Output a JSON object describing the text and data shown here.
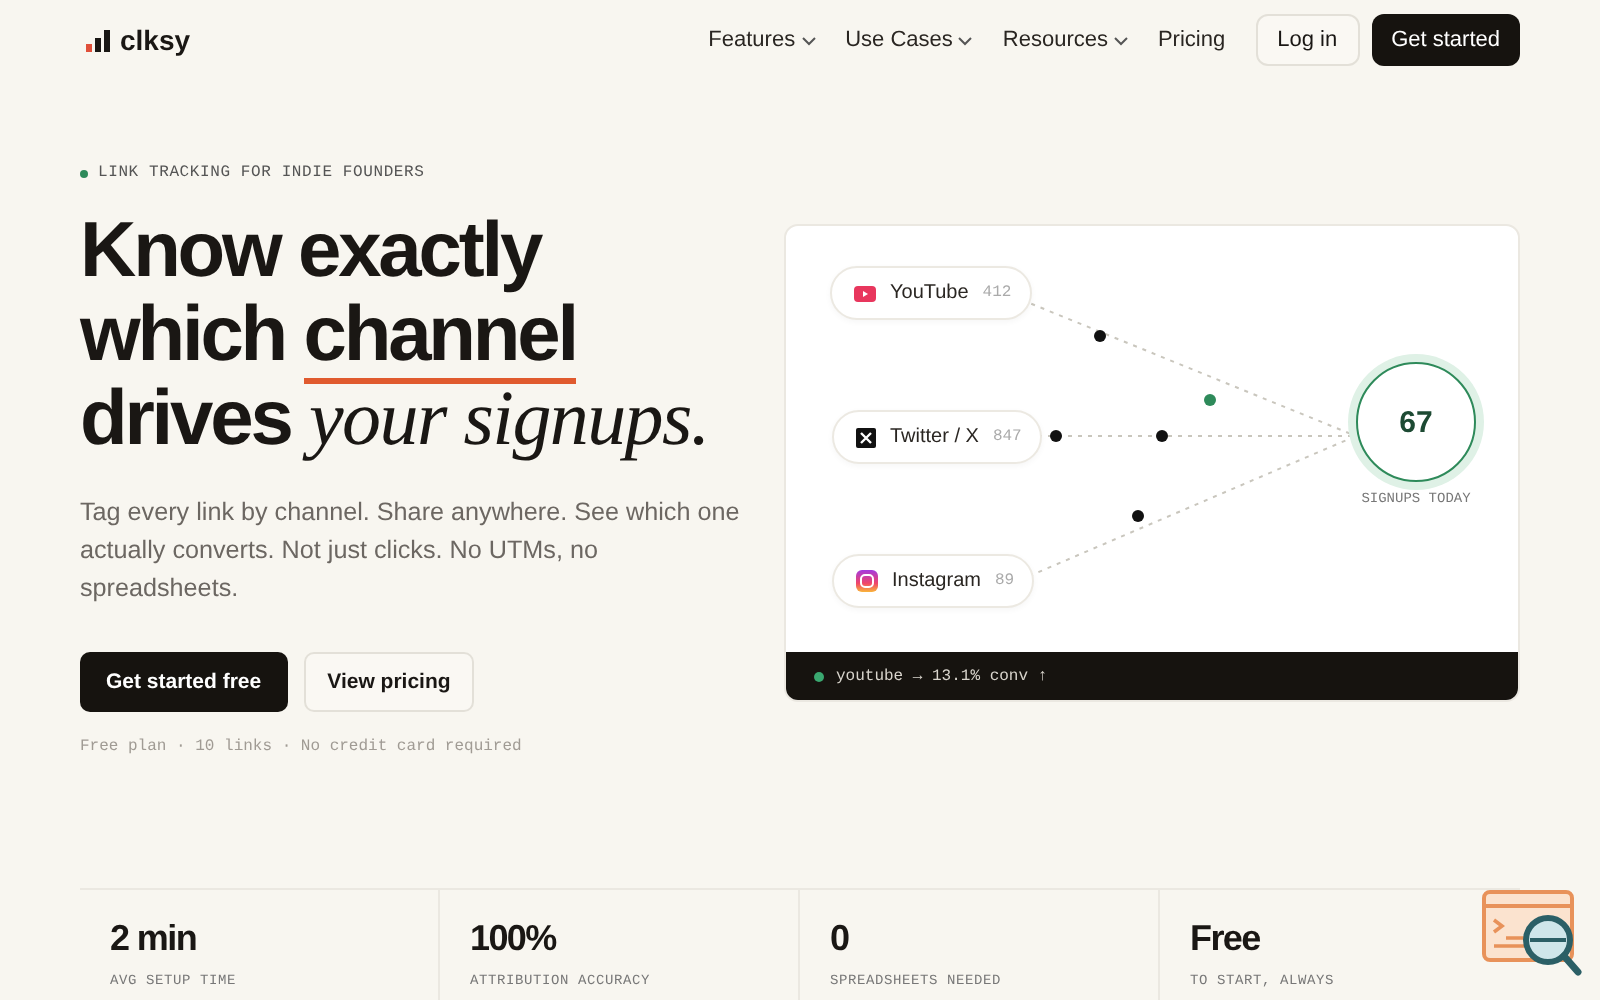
{
  "nav": {
    "logo": "clksy",
    "links": [
      {
        "label": "Features",
        "dropdown": true
      },
      {
        "label": "Use Cases",
        "dropdown": true
      },
      {
        "label": "Resources",
        "dropdown": true
      },
      {
        "label": "Pricing",
        "dropdown": false
      }
    ],
    "login": "Log in",
    "cta": "Get started"
  },
  "hero": {
    "eyebrow": "LINK TRACKING FOR INDIE FOUNDERS",
    "headline": {
      "before": "Know exactly which",
      "underlined": "channel",
      "after": "drives",
      "italic": "your signups."
    },
    "subtitle": "Tag every link by channel. Share anywhere. See which one actually converts. Not just clicks. No UTMs, no spreadsheets.",
    "primary_button": "Get started free",
    "secondary_button": "View pricing",
    "note": "Free plan · 10 links · No credit card required"
  },
  "diagram": {
    "channels": [
      {
        "kind": "youtube",
        "name": "YouTube",
        "count": "412"
      },
      {
        "kind": "x",
        "name": "Twitter / X",
        "count": "847"
      },
      {
        "kind": "instagram",
        "name": "Instagram",
        "count": "89"
      }
    ],
    "total": "67",
    "total_label": "SIGNUPS TODAY",
    "status": "youtube → 13.1% conv ↑"
  },
  "stats": [
    {
      "value": "2 min",
      "label": "AVG SETUP TIME"
    },
    {
      "value": "100%",
      "label": "ATTRIBUTION ACCURACY"
    },
    {
      "value": "0",
      "label": "SPREADSHEETS NEEDED"
    },
    {
      "value": "Free",
      "label": "TO START, ALWAYS"
    }
  ]
}
